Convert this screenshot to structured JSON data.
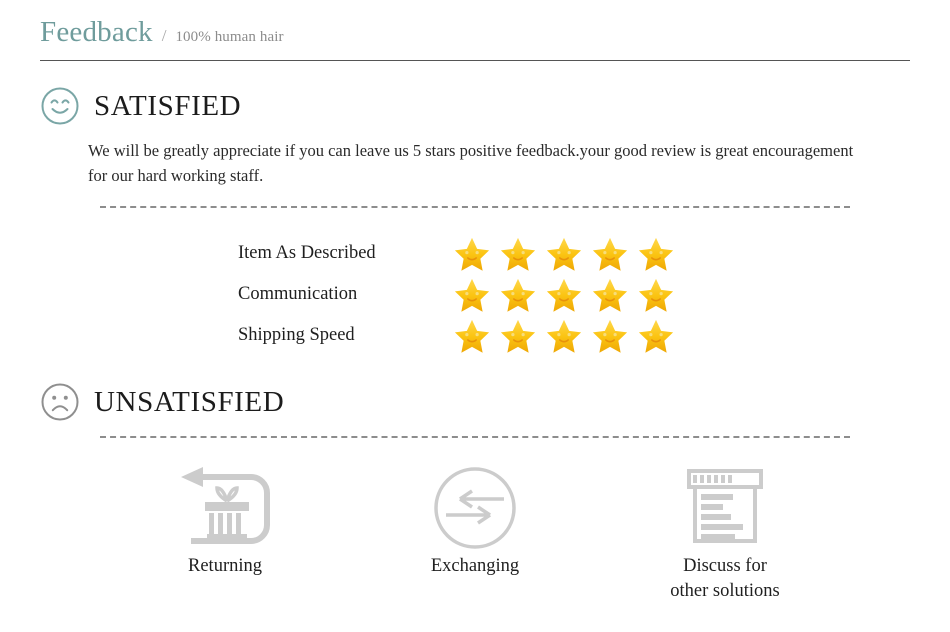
{
  "header": {
    "title": "Feedback",
    "separator": "/",
    "subtitle": "100% human hair"
  },
  "satisfied": {
    "icon": "smiley-face-icon",
    "heading": "SATISFIED",
    "paragraph": "We will be greatly appreciate if you can leave us 5 stars positive feedback.your good review is great encouragement for our hard working staff.",
    "ratings": [
      {
        "label": "Item As Described",
        "stars": 5
      },
      {
        "label": "Communication",
        "stars": 5
      },
      {
        "label": "Shipping Speed",
        "stars": 5
      }
    ]
  },
  "unsatisfied": {
    "icon": "frowning-face-icon",
    "heading": "UNSATISFIED",
    "options": [
      {
        "icon": "return-package-icon",
        "label": "Returning"
      },
      {
        "icon": "exchange-arrows-icon",
        "label": "Exchanging"
      },
      {
        "icon": "discussion-window-icon",
        "label": "Discuss for\nother solutions"
      }
    ]
  },
  "colors": {
    "accent_teal": "#6f9c9c",
    "star_gold": "#f5c518",
    "icon_gray": "#c9c9c9",
    "rule_gray": "#555555",
    "dash_gray": "#8d8d8d"
  }
}
